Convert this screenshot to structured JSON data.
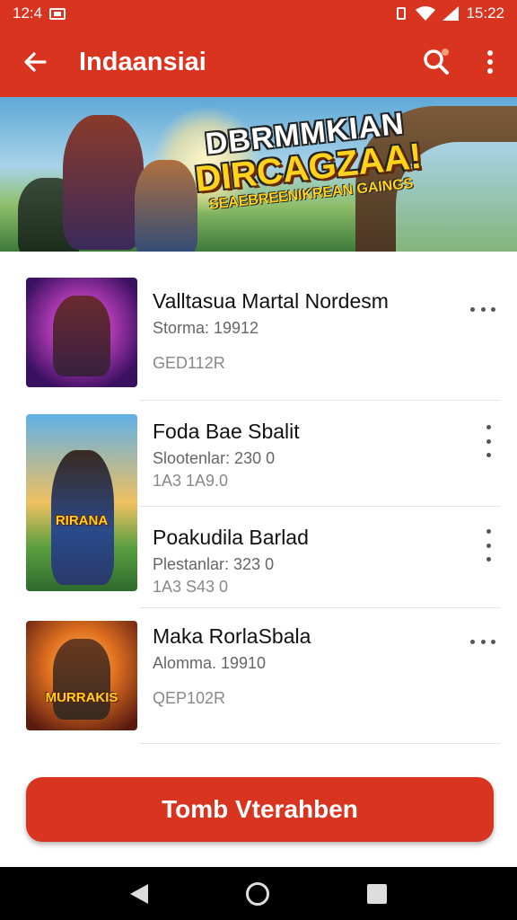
{
  "status_bar": {
    "time_left": "12:4",
    "time_right": "15:22"
  },
  "app_bar": {
    "title": "Indaansiai",
    "back_icon": "arrow-left-icon",
    "search_icon": "search-icon",
    "menu_icon": "more-vert-icon"
  },
  "banner": {
    "line1": "DBRMMKIAN",
    "line2": "DIRCAGZAA!",
    "line3": "SEAEBREENIKREAN GAINGS"
  },
  "games": [
    {
      "name": "Valltasua Martal Nordesm",
      "sub": "Storma: 19912",
      "code": "GED112R",
      "more": "more-horiz-icon"
    },
    {
      "name": "Foda Bae Sbalit",
      "sub": "Slootenlar: 230 0",
      "code": "1A3 1A9.0",
      "more": "more-vert-icon"
    },
    {
      "name": "Poakudila Barlad",
      "sub": "Plestanlar: 323 0",
      "code": "1A3 S43 0",
      "more": "more-vert-icon",
      "thumb_badge": "RIRANA"
    },
    {
      "name": "Maka RorlaSbala",
      "sub": "Alomma. 19910",
      "code": "QEP102R",
      "more": "more-horiz-icon",
      "thumb_badge": "MURRAKIS"
    }
  ],
  "cta": {
    "label": "Tomb Vterahben"
  },
  "colors": {
    "accent": "#d9341f",
    "navbar": "#000000"
  }
}
